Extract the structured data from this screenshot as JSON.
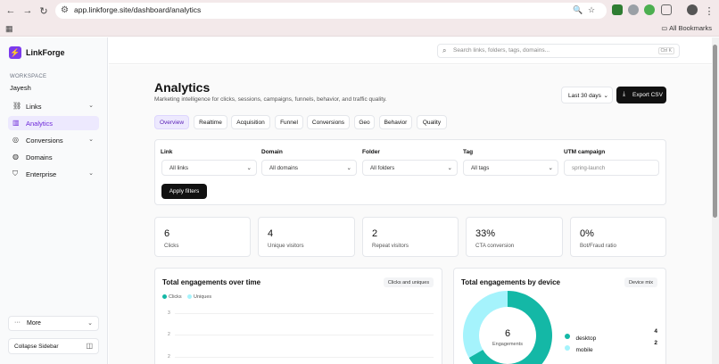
{
  "browser": {
    "url": "app.linkforge.site/dashboard/analytics",
    "all_bookmarks": "All Bookmarks"
  },
  "sidebar": {
    "brand": "LinkForge",
    "workspace_label": "WORKSPACE",
    "workspace_name": "Jayesh",
    "items": [
      {
        "label": "Links",
        "icon": "link-icon",
        "has_chevron": true
      },
      {
        "label": "Analytics",
        "icon": "chart-icon",
        "has_chevron": false,
        "active": true
      },
      {
        "label": "Conversions",
        "icon": "target-icon",
        "has_chevron": true
      },
      {
        "label": "Domains",
        "icon": "globe-icon",
        "has_chevron": false
      },
      {
        "label": "Enterprise",
        "icon": "shield-icon",
        "has_chevron": true
      }
    ],
    "more": "More",
    "collapse": "Collapse Sidebar"
  },
  "search": {
    "placeholder": "Search links, folders, tags, domains...",
    "shortcut": "Ctrl K"
  },
  "page": {
    "title": "Analytics",
    "subtitle": "Marketing intelligence for clicks, sessions, campaigns, funnels, behavior, and traffic quality.",
    "range": "Last 30 days",
    "export": "Export CSV"
  },
  "tabs": [
    "Overview",
    "Realtime",
    "Acquisition",
    "Funnel",
    "Conversions",
    "Geo",
    "Behavior",
    "Quality"
  ],
  "filters": {
    "fields": [
      {
        "label": "Link",
        "value": "All links"
      },
      {
        "label": "Domain",
        "value": "All domains"
      },
      {
        "label": "Folder",
        "value": "All folders"
      },
      {
        "label": "Tag",
        "value": "All tags"
      },
      {
        "label": "UTM campaign",
        "value": "spring-launch",
        "is_input": true
      }
    ],
    "apply": "Apply filters"
  },
  "stats": [
    {
      "value": "6",
      "label": "Clicks"
    },
    {
      "value": "4",
      "label": "Unique visitors"
    },
    {
      "value": "2",
      "label": "Repeat visitors"
    },
    {
      "value": "33%",
      "label": "CTA conversion"
    },
    {
      "value": "0%",
      "label": "Bot/Fraud ratio"
    }
  ],
  "engagement_chart": {
    "title": "Total engagements over time",
    "toggle": "Clicks and uniques",
    "legend": [
      {
        "name": "Clicks",
        "color": "#14b8a6"
      },
      {
        "name": "Uniques",
        "color": "#a5f3fc"
      }
    ],
    "yticks": [
      "3",
      "2",
      "2"
    ]
  },
  "device_chart": {
    "title": "Total engagements by device",
    "toggle": "Device mix",
    "center_value": "6",
    "center_label": "Engagements",
    "items": [
      {
        "name": "desktop",
        "value": 4,
        "color": "#14b8a6"
      },
      {
        "name": "mobile",
        "value": 2,
        "color": "#a5f3fc"
      }
    ]
  },
  "colors": {
    "accent": "#6d28d9",
    "teal": "#14b8a6",
    "cyan": "#a5f3fc"
  }
}
